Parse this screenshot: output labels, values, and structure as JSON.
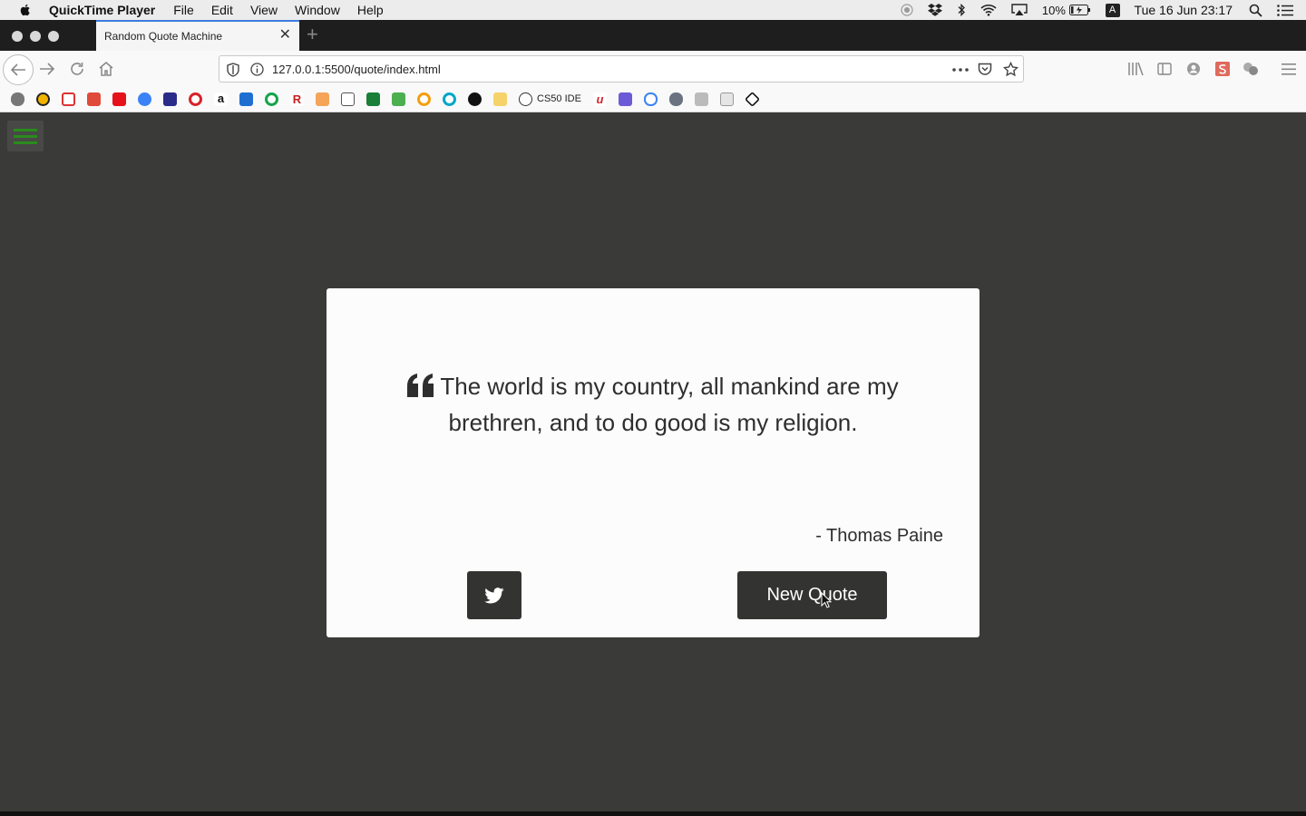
{
  "menubar": {
    "app_name": "QuickTime Player",
    "items": [
      "File",
      "Edit",
      "View",
      "Window",
      "Help"
    ],
    "battery": "10%",
    "input_source": "A",
    "clock": "Tue 16 Jun  23:17"
  },
  "browser": {
    "tab_title": "Random Quote Machine",
    "url": "127.0.0.1:5500/quote/index.html",
    "bookmark_label": "CS50 IDE"
  },
  "quote": {
    "text": "The world is my country, all mankind are my brethren, and to do good is my religion.",
    "author": "- Thomas Paine",
    "new_quote_label": "New Quote"
  },
  "colors": {
    "page_bg": "#3a3a38",
    "card_bg": "#fcfcfc",
    "button_bg": "#333331",
    "hamburger_accent": "#2a8a1e"
  }
}
